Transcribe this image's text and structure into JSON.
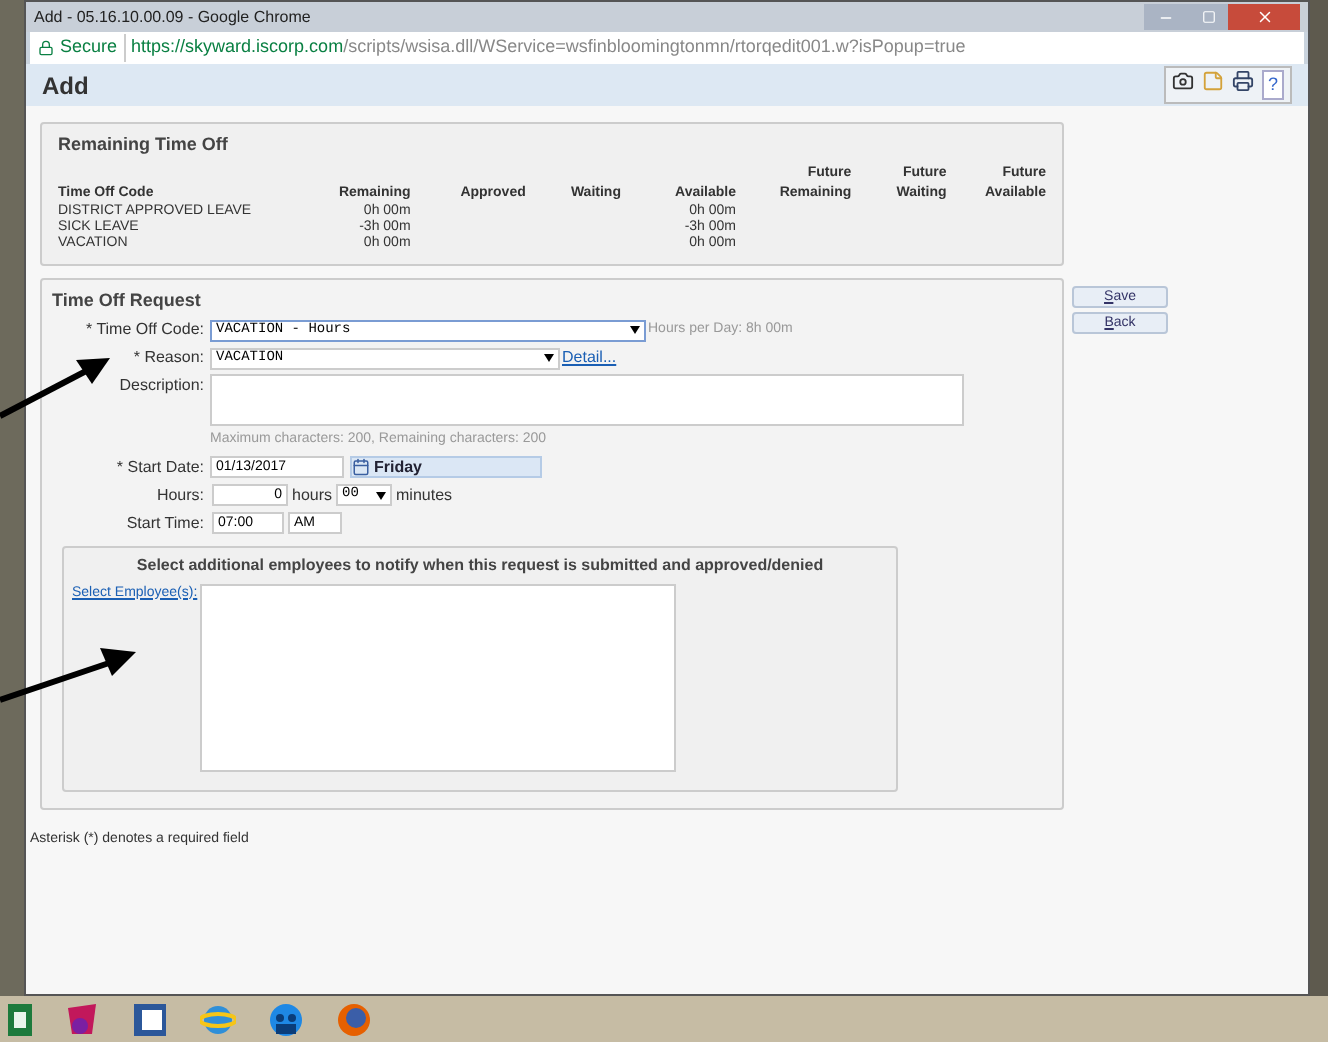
{
  "window": {
    "title": "Add - 05.16.10.00.09 - Google Chrome"
  },
  "address_bar": {
    "secure_label": "Secure",
    "url_host": "https://skyward.iscorp.com",
    "url_path": "/scripts/wsisa.dll/WService=wsfinbloomingtonmn/rtorqedit001.w?isPopup=true"
  },
  "page_header": {
    "title": "Add",
    "help": "?"
  },
  "remaining_time_off": {
    "title": "Remaining Time Off",
    "columns": [
      "Time Off Code",
      "Remaining",
      "Approved",
      "Waiting",
      "Available",
      "Future Remaining",
      "Future Waiting",
      "Future Available"
    ],
    "rows": [
      [
        "DISTRICT APPROVED LEAVE",
        "0h 00m",
        "",
        "",
        "0h 00m",
        "",
        "",
        ""
      ],
      [
        "SICK LEAVE",
        "-3h 00m",
        "",
        "",
        "-3h 00m",
        "",
        "",
        ""
      ],
      [
        "VACATION",
        "0h 00m",
        "",
        "",
        "0h 00m",
        "",
        "",
        ""
      ]
    ]
  },
  "time_off_request": {
    "title": "Time Off Request",
    "time_off_code": {
      "label": "* Time Off Code:",
      "value": "VACATION - Hours",
      "hint": "Hours per Day: 8h 00m"
    },
    "reason": {
      "label": "* Reason:",
      "value": "VACATION",
      "link": "Detail..."
    },
    "description": {
      "label": "Description:",
      "hint": "Maximum characters: 200, Remaining characters: 200"
    },
    "start_date": {
      "label": "* Start Date:",
      "value": "01/13/2017",
      "day": "Friday"
    },
    "hours": {
      "label": "Hours:",
      "value": "0",
      "unit": "hours",
      "minutes": "00",
      "minutes_unit": "minutes"
    },
    "start_time": {
      "label": "Start Time:",
      "value": "07:00",
      "ampm": "AM"
    },
    "notify": {
      "heading": "Select additional employees to notify when this request is submitted and approved/denied",
      "link": "Select Employee(s):"
    }
  },
  "buttons": [
    "Save",
    "Back"
  ],
  "footnote": "Asterisk (*) denotes a required field"
}
